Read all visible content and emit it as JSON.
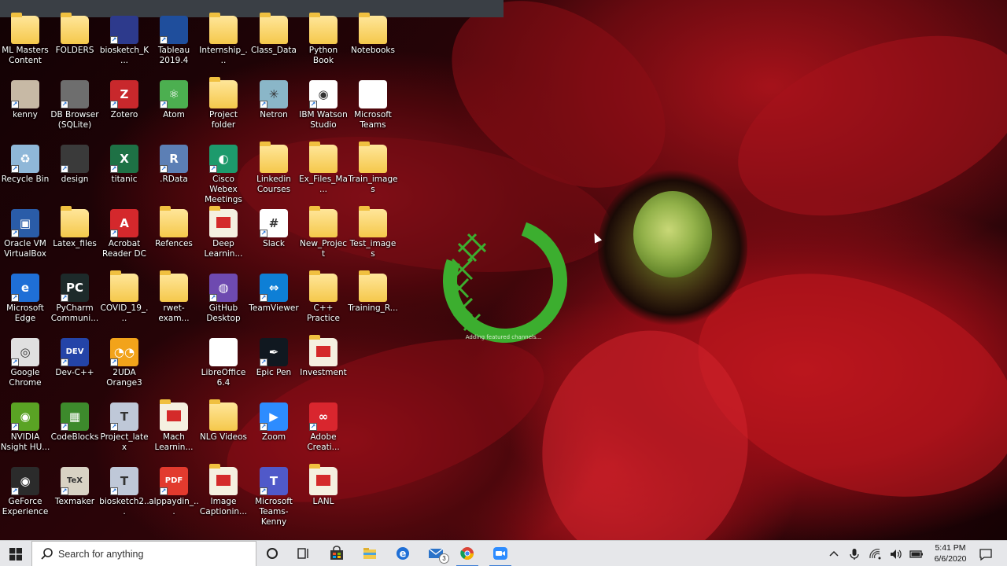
{
  "desktop": {
    "icons": [
      {
        "label": "ML Masters Content",
        "kind": "folder"
      },
      {
        "label": "FOLDERS",
        "kind": "folder"
      },
      {
        "label": "biosketch_K...",
        "kind": "app",
        "color": "#2d3a8c"
      },
      {
        "label": "Tableau 2019.4",
        "kind": "app",
        "color": "#1f4e9c"
      },
      {
        "label": "Internship_...",
        "kind": "folder"
      },
      {
        "label": "Class_Data",
        "kind": "folder"
      },
      {
        "label": "Python Book",
        "kind": "folder"
      },
      {
        "label": "Notebooks",
        "kind": "folder"
      },
      {
        "label": "kenny",
        "kind": "photo",
        "color": "#c7b9a5"
      },
      {
        "label": "DB Browser (SQLite)",
        "kind": "app",
        "color": "#6e6e6e"
      },
      {
        "label": "Zotero",
        "kind": "app",
        "color": "#c8282c",
        "glyph": "Z"
      },
      {
        "label": "Atom",
        "kind": "app",
        "color": "#4caf50",
        "glyph": "⚛"
      },
      {
        "label": "Project folder",
        "kind": "folder"
      },
      {
        "label": "Netron",
        "kind": "app",
        "color": "#8ab6c8",
        "glyph": "✳"
      },
      {
        "label": "IBM Watson Studio",
        "kind": "app",
        "color": "#ffffff",
        "glyph": "◉"
      },
      {
        "label": "Microsoft Teams",
        "kind": "doc"
      },
      {
        "label": "Recycle Bin",
        "kind": "app",
        "color": "#8fb7d8",
        "glyph": "♻"
      },
      {
        "label": "design",
        "kind": "photo",
        "color": "#3a3a3a"
      },
      {
        "label": "titanic",
        "kind": "app",
        "color": "#1e7145",
        "glyph": "X"
      },
      {
        "label": ".RData",
        "kind": "app",
        "color": "#5c7fb5",
        "glyph": "R"
      },
      {
        "label": "Cisco Webex Meetings",
        "kind": "app",
        "color": "#1d9a6c",
        "glyph": "◐"
      },
      {
        "label": "Linkedin Courses",
        "kind": "folder"
      },
      {
        "label": "Ex_Files_Ma...",
        "kind": "folder"
      },
      {
        "label": "Train_images",
        "kind": "folder"
      },
      {
        "label": "Oracle VM VirtualBox",
        "kind": "app",
        "color": "#2a5ca8",
        "glyph": "▣"
      },
      {
        "label": "Latex_files",
        "kind": "folder"
      },
      {
        "label": "Acrobat Reader DC",
        "kind": "app",
        "color": "#d4282c",
        "glyph": "A"
      },
      {
        "label": "Refences",
        "kind": "folder"
      },
      {
        "label": "Deep Learnin...",
        "kind": "pdf"
      },
      {
        "label": "Slack",
        "kind": "app",
        "color": "#ffffff",
        "glyph": "#"
      },
      {
        "label": "New_Project",
        "kind": "folder"
      },
      {
        "label": "Test_images",
        "kind": "folder"
      },
      {
        "label": "Microsoft Edge",
        "kind": "app",
        "color": "#1f6fd6",
        "glyph": "e"
      },
      {
        "label": "PyCharm Communi...",
        "kind": "app",
        "color": "#1d2a2a",
        "glyph": "PC"
      },
      {
        "label": "COVID_19_...",
        "kind": "folder"
      },
      {
        "label": "rwet-exam...",
        "kind": "folder"
      },
      {
        "label": "GitHub Desktop",
        "kind": "app",
        "color": "#6e4ab0",
        "glyph": "◍"
      },
      {
        "label": "TeamViewer",
        "kind": "app",
        "color": "#0e7fd6",
        "glyph": "⇔"
      },
      {
        "label": "C++ Practice",
        "kind": "folder"
      },
      {
        "label": "Training_R...",
        "kind": "folder"
      },
      {
        "label": "Google Chrome",
        "kind": "app",
        "color": "#e0e0e0",
        "glyph": "◎"
      },
      {
        "label": "Dev-C++",
        "kind": "app",
        "color": "#2444a8",
        "glyph": "DEV"
      },
      {
        "label": "2UDA Orange3",
        "kind": "app",
        "color": "#f2a31a",
        "glyph": "◔◔"
      },
      {
        "label": "",
        "kind": "none"
      },
      {
        "label": "LibreOffice 6.4",
        "kind": "doc"
      },
      {
        "label": "Epic Pen",
        "kind": "app",
        "color": "#101820",
        "glyph": "✒"
      },
      {
        "label": "Investment",
        "kind": "pdf"
      },
      {
        "label": "",
        "kind": "none"
      },
      {
        "label": "NVIDIA Nsight HU...",
        "kind": "app",
        "color": "#5aa324",
        "glyph": "◉"
      },
      {
        "label": "CodeBlocks",
        "kind": "app",
        "color": "#3d8a2c",
        "glyph": "▦"
      },
      {
        "label": "Project_latex",
        "kind": "app",
        "color": "#bfc8d8",
        "glyph": "T"
      },
      {
        "label": "Mach Learnin...",
        "kind": "pdf"
      },
      {
        "label": "NLG Videos",
        "kind": "folder"
      },
      {
        "label": "Zoom",
        "kind": "app",
        "color": "#2d8cff",
        "glyph": "▶"
      },
      {
        "label": "Adobe Creati...",
        "kind": "app",
        "color": "#d9262e",
        "glyph": "∞"
      },
      {
        "label": "",
        "kind": "none"
      },
      {
        "label": "GeForce Experience",
        "kind": "app",
        "color": "#2b2b2b",
        "glyph": "◉"
      },
      {
        "label": "Texmaker",
        "kind": "app",
        "color": "#d8d2c4",
        "glyph": "TeX"
      },
      {
        "label": "biosketch2...",
        "kind": "app",
        "color": "#bfc8d8",
        "glyph": "T"
      },
      {
        "label": "alppaydin_...",
        "kind": "app",
        "color": "#e23a2e",
        "glyph": "PDF"
      },
      {
        "label": "Image Captionin...",
        "kind": "pdf"
      },
      {
        "label": "Microsoft Teams-Kenny",
        "kind": "app",
        "color": "#5059c9",
        "glyph": "T"
      },
      {
        "label": "LANL",
        "kind": "pdf"
      },
      {
        "label": "",
        "kind": "none"
      }
    ]
  },
  "loader": {
    "text": "Adding featured channels...",
    "color": "#3cae2f"
  },
  "taskbar": {
    "search_placeholder": "Search for anything",
    "mail_badge": "3",
    "time": "5:41 PM",
    "date": "6/6/2020"
  }
}
